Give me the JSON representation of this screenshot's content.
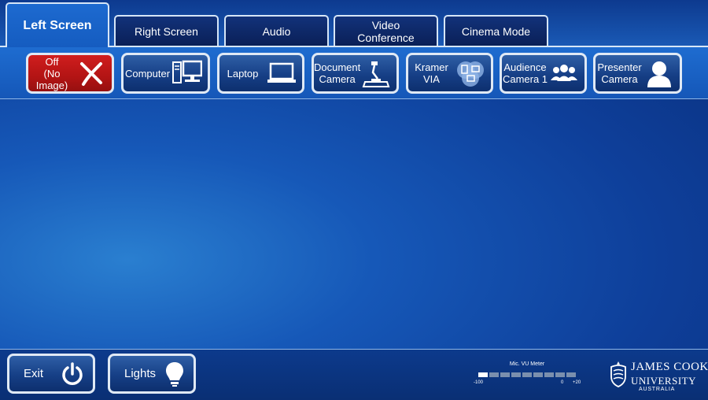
{
  "tabs": [
    {
      "label": "Left Screen",
      "active": true
    },
    {
      "label": "Right Screen",
      "active": false
    },
    {
      "label": "Audio",
      "active": false
    },
    {
      "label": "Video Conference",
      "active": false
    },
    {
      "label": "Cinema Mode",
      "active": false
    }
  ],
  "sources": [
    {
      "line1": "Off",
      "line2": "(No Image)",
      "icon": "x-icon",
      "color": "#c81818"
    },
    {
      "line1": "Computer",
      "line2": "",
      "icon": "computer-icon"
    },
    {
      "line1": "Laptop",
      "line2": "",
      "icon": "laptop-icon"
    },
    {
      "line1": "Document",
      "line2": "Camera",
      "icon": "document-camera-icon"
    },
    {
      "line1": "Kramer",
      "line2": "VIA",
      "icon": "kramer-via-icon"
    },
    {
      "line1": "Audience",
      "line2": "Camera 1",
      "icon": "audience-icon"
    },
    {
      "line1": "Presenter",
      "line2": "Camera",
      "icon": "presenter-icon"
    }
  ],
  "bottom": {
    "exit_label": "Exit",
    "lights_label": "Lights"
  },
  "vu_meter": {
    "title": "Mic. VU Meter",
    "min_label": "-100",
    "zero_label": "0",
    "max_label": "+20",
    "level_fraction": 0.12
  },
  "logo": {
    "line1": "JAMES COOK",
    "line2": "UNIVERSITY",
    "line3": "AUSTRALIA"
  },
  "colors": {
    "accent_blue": "#1557b8",
    "button_border": "#dfe9f5",
    "off_red": "#c81818"
  }
}
